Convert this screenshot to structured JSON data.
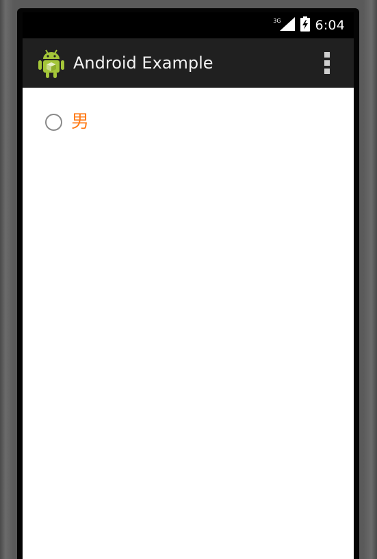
{
  "status_bar": {
    "network_type": "3G",
    "time": "6:04",
    "icons": [
      "signal-icon",
      "battery-charging-icon"
    ]
  },
  "action_bar": {
    "app_icon": "android-robot-icon",
    "title": "Android Example",
    "overflow_icon": "overflow-menu-icon"
  },
  "content": {
    "radio": {
      "label": "男",
      "checked": false,
      "label_color": "#ff7b17"
    }
  },
  "colors": {
    "status_bar_bg": "#000000",
    "action_bar_bg": "#202020",
    "content_bg": "#ffffff",
    "accent": "#ff7b17",
    "android_green": "#a4c639"
  }
}
